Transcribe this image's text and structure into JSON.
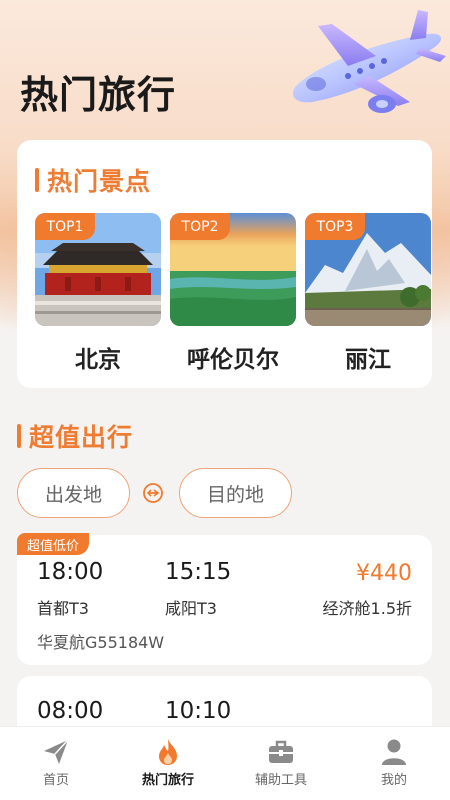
{
  "header": {
    "title": "热门旅行"
  },
  "hot_spots": {
    "section_title": "热门景点",
    "items": [
      {
        "rank": "TOP1",
        "name": "北京",
        "image": "forbidden-city-photo"
      },
      {
        "rank": "TOP2",
        "name": "呼伦贝尔",
        "image": "grassland-sunset-photo"
      },
      {
        "rank": "TOP3",
        "name": "丽江",
        "image": "snow-mountain-photo"
      }
    ]
  },
  "deals": {
    "section_title": "超值出行",
    "from_placeholder": "出发地",
    "to_placeholder": "目的地",
    "flights": [
      {
        "badge": "超值低价",
        "depart_time": "18:00",
        "depart_airport": "首都T3",
        "arrive_time": "15:15",
        "arrive_airport": "咸阳T3",
        "price": "¥440",
        "cabin": "经济舱1.5折",
        "flight_no": "华夏航G55184W"
      },
      {
        "depart_time": "08:00",
        "arrive_time": "10:10"
      }
    ]
  },
  "tabbar": {
    "items": [
      {
        "label": "首页",
        "icon": "paper-plane-icon"
      },
      {
        "label": "热门旅行",
        "icon": "flame-icon",
        "active": true
      },
      {
        "label": "辅助工具",
        "icon": "briefcase-icon"
      },
      {
        "label": "我的",
        "icon": "user-icon"
      }
    ]
  },
  "colors": {
    "accent": "#f07a2e",
    "background": "#f5f3f1",
    "card": "#ffffff"
  }
}
